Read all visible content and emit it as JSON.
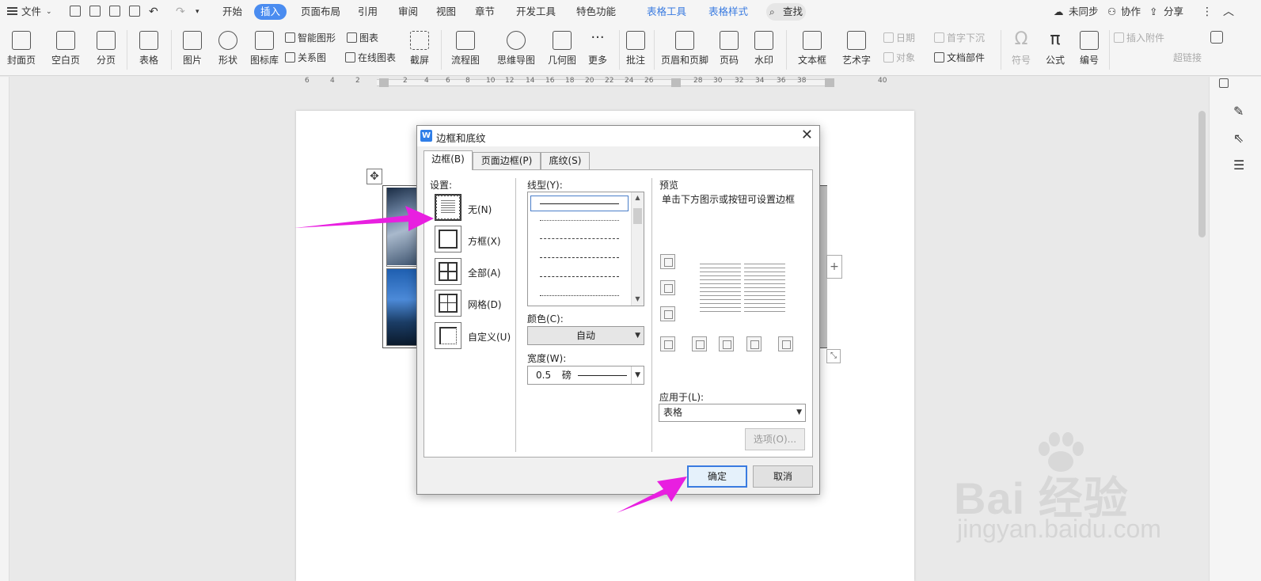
{
  "menubar": {
    "file": "文件",
    "tabs": [
      "开始",
      "插入",
      "页面布局",
      "引用",
      "审阅",
      "视图",
      "章节",
      "开发工具",
      "特色功能"
    ],
    "context_tabs": [
      "表格工具",
      "表格样式"
    ],
    "search": "查找",
    "right": [
      "未同步",
      "协作",
      "分享"
    ]
  },
  "ribbon": {
    "large": [
      "封面页",
      "空白页",
      "分页",
      "表格",
      "图片",
      "形状",
      "图标库",
      "流程图",
      "思维导图",
      "几何图",
      "更多",
      "批注",
      "页眉和页脚",
      "页码",
      "水印",
      "文本框",
      "艺术字",
      "符号",
      "公式",
      "编号"
    ],
    "small": [
      "智能图形",
      "图表",
      "关系图",
      "在线图表",
      "截屏",
      "日期",
      "首字下沉",
      "对象",
      "文档部件",
      "插入附件",
      "超链接"
    ]
  },
  "ruler": {
    "ticks": [
      "6",
      "4",
      "2",
      "2",
      "4",
      "6",
      "8",
      "10",
      "12",
      "14",
      "16",
      "18",
      "20",
      "22",
      "24",
      "26",
      "28",
      "30",
      "32",
      "34",
      "36",
      "38",
      "40"
    ]
  },
  "dialog": {
    "title": "边框和底纹",
    "tabs": [
      "边框(B)",
      "页面边框(P)",
      "底纹(S)"
    ],
    "settings_label": "设置:",
    "settings": [
      "无(N)",
      "方框(X)",
      "全部(A)",
      "网格(D)",
      "自定义(U)"
    ],
    "linestyle_label": "线型(Y):",
    "color_label": "颜色(C):",
    "color_value": "自动",
    "width_label": "宽度(W):",
    "width_value": "0.5",
    "width_unit": "磅",
    "preview_label": "预览",
    "preview_hint": "单击下方图示或按钮可设置边框",
    "apply_label": "应用于(L):",
    "apply_value": "表格",
    "options_button": "选项(O)...",
    "ok_button": "确定",
    "cancel_button": "取消"
  },
  "watermark": {
    "main": "Bai 经验",
    "sub": "jingyan.baidu.com"
  },
  "colors": {
    "accent": "#4a8cf0",
    "annotation_arrow": "#e81fe0"
  }
}
